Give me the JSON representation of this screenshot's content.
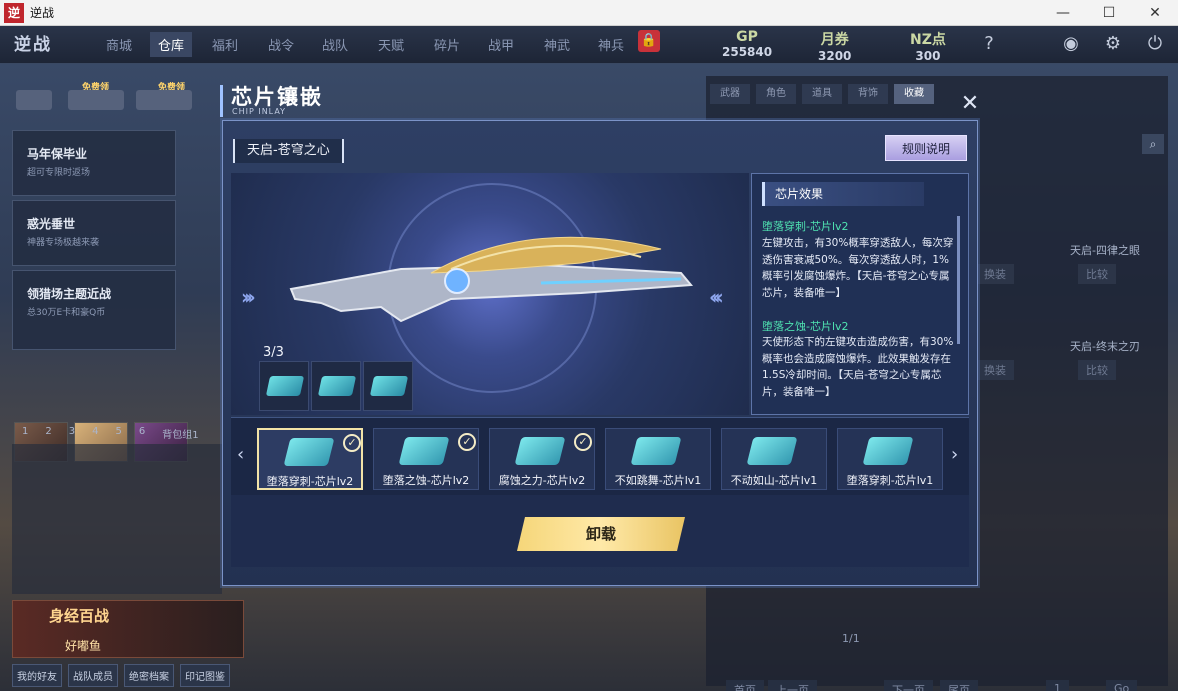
{
  "window": {
    "title": "逆战",
    "icon_text": "逆",
    "minimize": "—",
    "maximize": "☐",
    "close": "✕"
  },
  "topnav": {
    "logo": "逆战",
    "tabs": [
      "商城",
      "仓库",
      "福利",
      "战令",
      "战队",
      "天赋",
      "碎片",
      "战甲",
      "神武",
      "神兵"
    ],
    "active_tab": "仓库",
    "lock_icon": "lock-icon",
    "currencies": [
      {
        "name": "GP",
        "value": "255840"
      },
      {
        "name": "月券",
        "value": "3200"
      },
      {
        "name": "NZ点",
        "value": "300"
      }
    ],
    "icons": [
      "help-icon",
      "settings-icon",
      "gear-icon",
      "power-icon"
    ]
  },
  "left": {
    "free1": "免费领",
    "free2": "免费领",
    "promos": [
      {
        "title": "马年保毕业",
        "sub": "超可专限时返场"
      },
      {
        "title": "惑光垂世",
        "sub": "神器专场极越来袭"
      },
      {
        "title": "领猎场主题近战",
        "sub": "总30万E卡和豪Q币"
      }
    ],
    "slots": [
      "1",
      "2",
      "3",
      "4",
      "5",
      "6",
      "背包组1"
    ],
    "banner_title": "身经百战",
    "banner_user": "好嘟鱼",
    "bottom_buttons": [
      "我的好友",
      "战队成员",
      "绝密档案",
      "印记图鉴"
    ]
  },
  "right": {
    "tabs": [
      "武器",
      "角色",
      "道具",
      "背饰",
      "收藏"
    ],
    "active_tab": "收藏",
    "items": [
      {
        "name": "天启-四律之眼",
        "btn1": "换装",
        "btn2": "比较"
      },
      {
        "name": "天启-终末之刃",
        "btn1": "换装",
        "btn2": "比较"
      }
    ],
    "pager": {
      "first": "首页",
      "prev": "上一页",
      "info": "1/1",
      "next": "下一页",
      "last": "尾页",
      "input": "1",
      "go": "Go"
    }
  },
  "dialog": {
    "title": "芯片镶嵌",
    "subtitle": "CHIP INLAY",
    "close": "✕",
    "weapon_name": "天启-苍穹之心",
    "rules_button": "规则说明",
    "chip_count": "3/3",
    "effects_title": "芯片效果",
    "effects": [
      {
        "name": "堕落穿刺-芯片lv2",
        "desc": "左键攻击，有30%概率穿透敌人，每次穿透伤害衰减50%。每次穿透敌人时，1%概率引发腐蚀爆炸。【天启-苍穹之心专属芯片，装备唯一】"
      },
      {
        "name": "堕落之蚀-芯片lv2",
        "desc": "天使形态下的左键攻击造成伤害，有30%概率也会造成腐蚀爆炸。此效果触发存在1.5S冷却时间。【天启-苍穹之心专属芯片，装备唯一】"
      }
    ],
    "chips": [
      {
        "label": "堕落穿刺-芯片lv2",
        "equipped": "✓"
      },
      {
        "label": "堕落之蚀-芯片lv2",
        "equipped": "✓"
      },
      {
        "label": "腐蚀之力-芯片lv2",
        "equipped": "✓"
      },
      {
        "label": "不如跳舞-芯片lv1",
        "equipped": ""
      },
      {
        "label": "不动如山-芯片lv1",
        "equipped": ""
      },
      {
        "label": "堕落穿刺-芯片lv1",
        "equipped": ""
      }
    ],
    "unload_button": "卸载"
  }
}
